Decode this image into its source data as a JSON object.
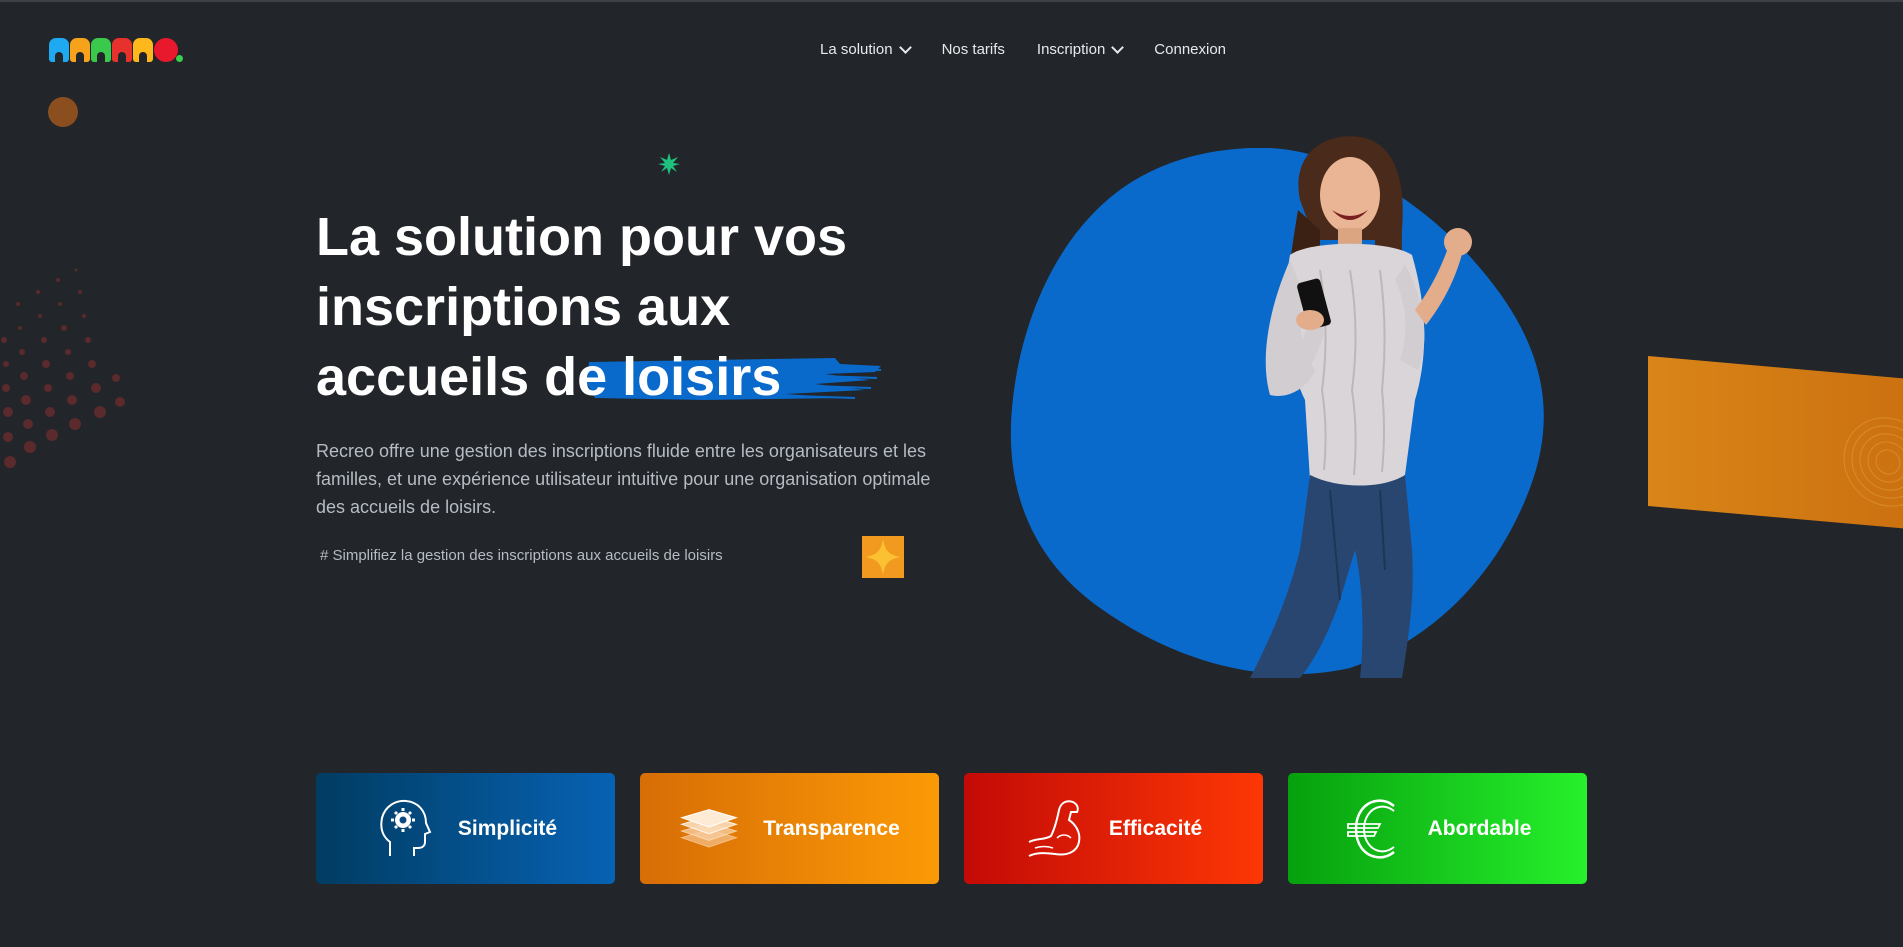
{
  "nav": {
    "items": [
      {
        "label": "La solution",
        "has_dropdown": true
      },
      {
        "label": "Nos tarifs",
        "has_dropdown": false
      },
      {
        "label": "Inscription",
        "has_dropdown": true
      },
      {
        "label": "Connexion",
        "has_dropdown": false
      }
    ]
  },
  "logo": {
    "icon": "recreo-logo",
    "text": "RECREO"
  },
  "hero": {
    "title_line1": "La solution pour vos",
    "title_line2": "inscriptions aux",
    "title_line3_start": "accueils d",
    "title_highlight": "e loisirs",
    "subtitle": "Recreo offre une gestion des inscriptions fluide entre les organisateurs et les familles, et une expérience utilisateur intuitive pour une organisation optimale des accueils de loisirs.",
    "tagline": "# Simplifiez la gestion des inscriptions aux accueils de loisirs"
  },
  "features": [
    {
      "label": "Simplicité",
      "icon": "head-gear-icon"
    },
    {
      "label": "Transparence",
      "icon": "layers-icon"
    },
    {
      "label": "Efficacité",
      "icon": "muscle-arm-icon"
    },
    {
      "label": "Abordable",
      "icon": "euro-icon"
    }
  ],
  "colors": {
    "background": "#222529",
    "accent_blue": "#0a6acb",
    "simplicite": "#0762b3",
    "transparence": "#fb9a06",
    "efficacite": "#fd3705",
    "abordable": "#27f02c"
  }
}
